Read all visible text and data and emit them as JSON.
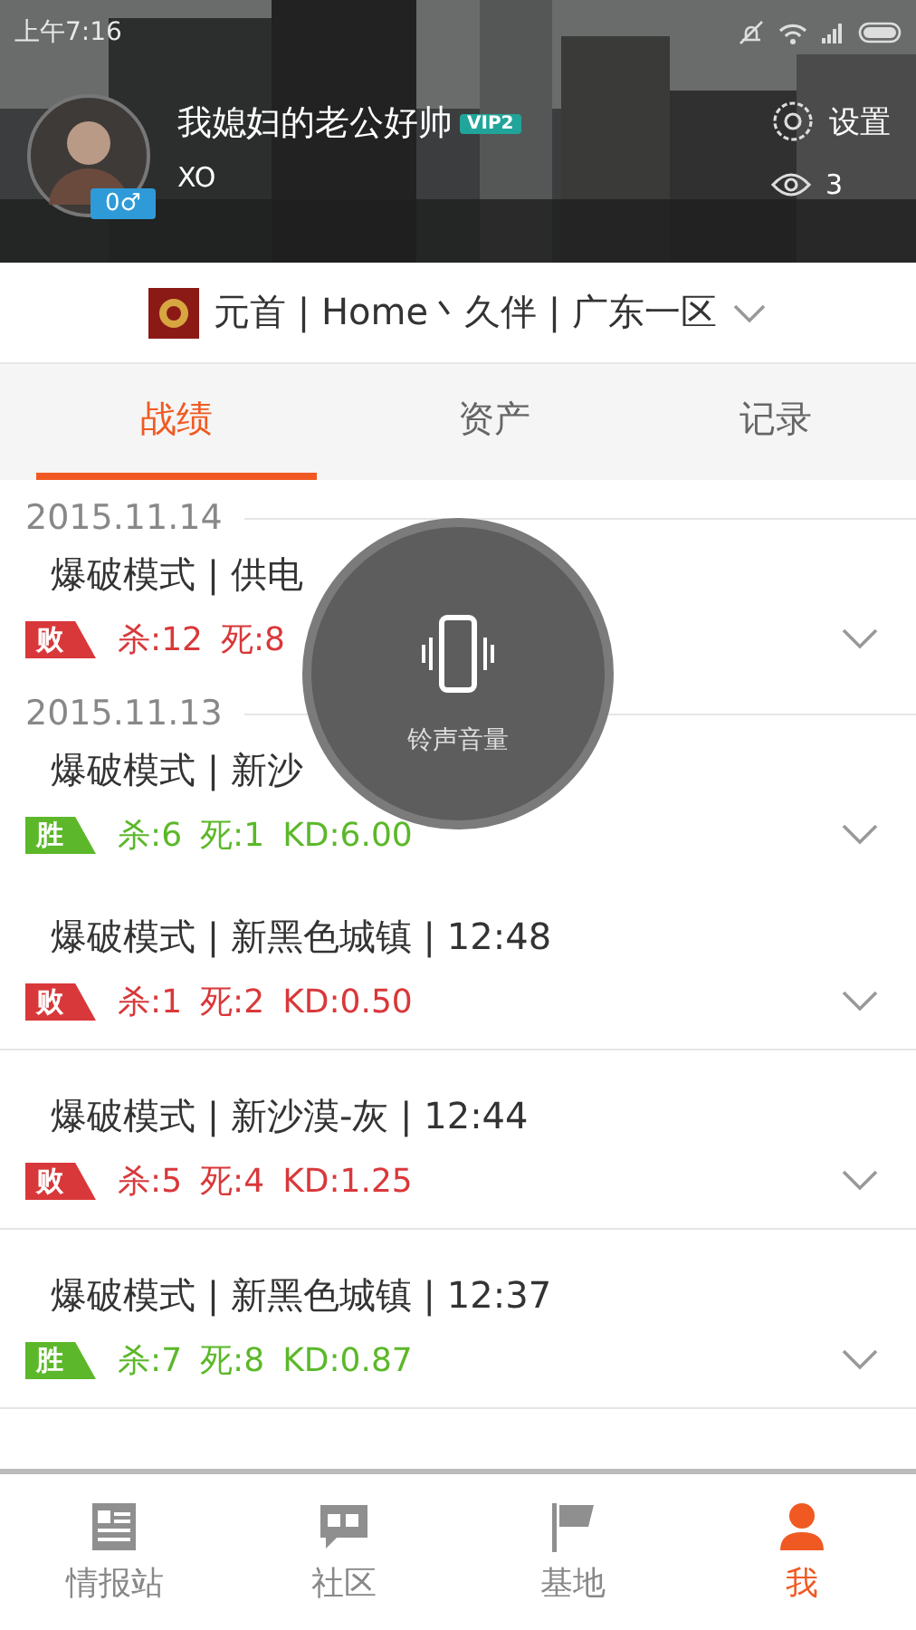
{
  "status_bar": {
    "time": "上午7:16"
  },
  "profile": {
    "name": "我媳妇的老公好帅",
    "vip": "VIP2",
    "level_badge": "0♂",
    "signature": "XO",
    "settings": "设置",
    "views": "3"
  },
  "team": {
    "name": "元首 | Home丶久伴 | 广东一区"
  },
  "tabs": [
    {
      "label": "战绩",
      "selected": true
    },
    {
      "label": "资产",
      "selected": false
    },
    {
      "label": "记录",
      "selected": false
    }
  ],
  "records": [
    {
      "date": "2015.11.14",
      "title": "爆破模式 | 供电",
      "kind": "lose",
      "result_label": "败",
      "kills": "杀:12",
      "deaths": "死:8"
    },
    {
      "date": "2015.11.13",
      "title": "爆破模式 | 新沙",
      "kind": "win",
      "result_label": "胜",
      "kills": "杀:6",
      "deaths": "死:1",
      "kd": "KD:6.00"
    },
    {
      "title": "爆破模式 | 新黑色城镇 | 12:48",
      "kind": "lose",
      "result_label": "败",
      "kills": "杀:1",
      "deaths": "死:2",
      "kd": "KD:0.50"
    },
    {
      "title": "爆破模式 | 新沙漠-灰 | 12:44",
      "kind": "lose",
      "result_label": "败",
      "kills": "杀:5",
      "deaths": "死:4",
      "kd": "KD:1.25"
    },
    {
      "title": "爆破模式 | 新黑色城镇 | 12:37",
      "kind": "win",
      "result_label": "胜",
      "kills": "杀:7",
      "deaths": "死:8",
      "kd": "KD:0.87"
    }
  ],
  "volume_toast": {
    "label": "铃声音量"
  },
  "bottom_nav": [
    {
      "label": "情报站",
      "kind": "news",
      "selected": false
    },
    {
      "label": "社区",
      "kind": "chat",
      "selected": false
    },
    {
      "label": "基地",
      "kind": "flag",
      "selected": false
    },
    {
      "label": "我",
      "kind": "person",
      "selected": true
    }
  ]
}
